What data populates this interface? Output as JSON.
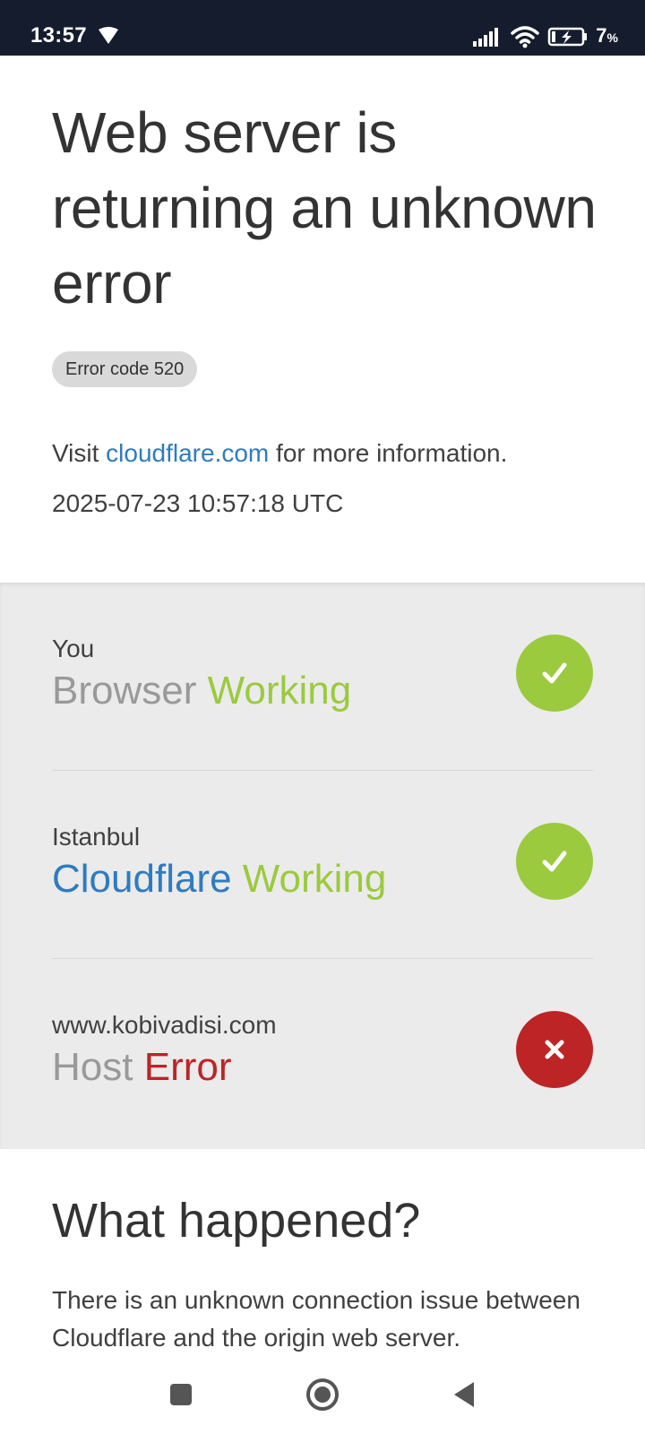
{
  "status_bar": {
    "time": "13:57",
    "battery_level": "7",
    "battery_unit": "%",
    "icons": [
      "location-icon",
      "signal-icon",
      "wifi-icon",
      "battery-charging-icon"
    ]
  },
  "header": {
    "title": "Web server is returning an unknown error",
    "error_code": "Error code 520",
    "info_prefix": "Visit ",
    "info_link": "cloudflare.com",
    "info_suffix": " for more information.",
    "timestamp": "2025-07-23 10:57:18 UTC"
  },
  "status_rows": [
    {
      "location": "You",
      "name": "Browser",
      "state": "Working",
      "ok": true
    },
    {
      "location": "Istanbul",
      "name": "Cloudflare",
      "state": "Working",
      "ok": true
    },
    {
      "location": "www.kobivadisi.com",
      "name": "Host",
      "state": "Error",
      "ok": false
    }
  ],
  "what_happened": {
    "title": "What happened?",
    "text": "There is an unknown connection issue between Cloudflare and the origin web server."
  },
  "colors": {
    "status_bar_bg": "#151c2e",
    "link_blue": "#2f7bbf",
    "ok_green": "#9bca3e",
    "error_red": "#bd2426",
    "panel_gray": "#ebebeb"
  }
}
